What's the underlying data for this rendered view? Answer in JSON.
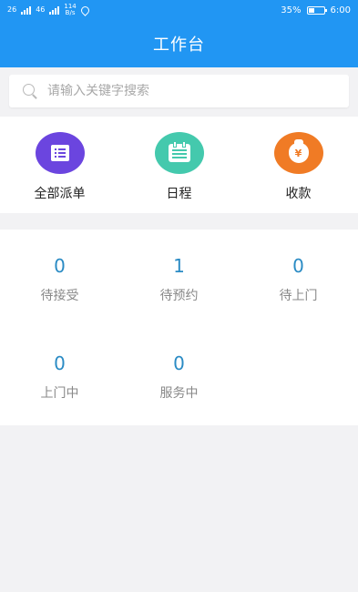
{
  "status_bar": {
    "sim1": "26",
    "sim2": "46",
    "net_speed_value": "114",
    "net_speed_unit": "B/s",
    "battery_percent": "35%",
    "battery_level": 0.35,
    "time": "6:00"
  },
  "header": {
    "title": "工作台"
  },
  "search": {
    "placeholder": "请输入关键字搜索",
    "value": ""
  },
  "quick_actions": [
    {
      "label": "全部派单",
      "icon": "list-icon",
      "color": "#6b45df"
    },
    {
      "label": "日程",
      "icon": "calendar-icon",
      "color": "#44c9ad"
    },
    {
      "label": "收款",
      "icon": "money-bag-icon",
      "color": "#f07b25",
      "symbol": "¥"
    }
  ],
  "stats": [
    {
      "count": "0",
      "label": "待接受"
    },
    {
      "count": "1",
      "label": "待预约"
    },
    {
      "count": "0",
      "label": "待上门"
    },
    {
      "count": "0",
      "label": "上门中"
    },
    {
      "count": "0",
      "label": "服务中"
    }
  ],
  "colors": {
    "primary": "#2196f3",
    "stat_number": "#2a8bc4",
    "background": "#f2f2f4"
  }
}
